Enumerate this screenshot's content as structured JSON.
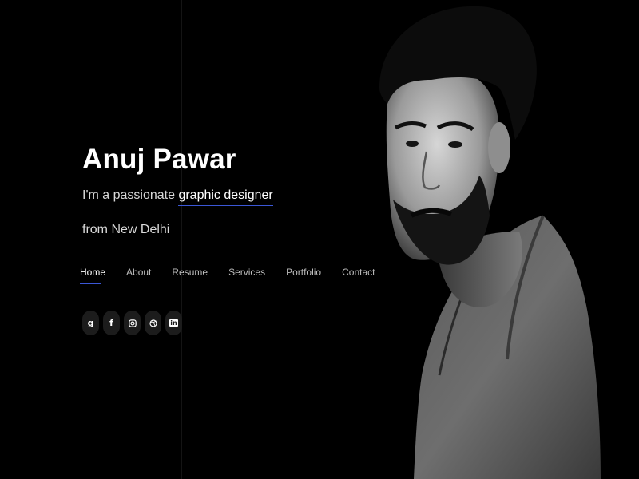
{
  "hero": {
    "name": "Anuj Pawar",
    "tagline_prefix": "I'm a passionate ",
    "tagline_highlight": "graphic designer",
    "location": "from New Delhi"
  },
  "nav": {
    "items": [
      {
        "label": "Home",
        "active": true
      },
      {
        "label": "About"
      },
      {
        "label": "Resume"
      },
      {
        "label": "Services"
      },
      {
        "label": "Portfolio"
      },
      {
        "label": "Contact"
      }
    ]
  },
  "social": {
    "icons": [
      "google-icon",
      "facebook-icon",
      "instagram-icon",
      "dribbble-icon",
      "linkedin-icon"
    ],
    "labels": {
      "google": "g",
      "facebook": "f",
      "linkedin": "in"
    }
  },
  "colors": {
    "background": "#000000",
    "accent": "#3b57d6",
    "text": "#ffffff",
    "muted": "#bdbdbd",
    "social_bg": "#1c1c1c"
  }
}
